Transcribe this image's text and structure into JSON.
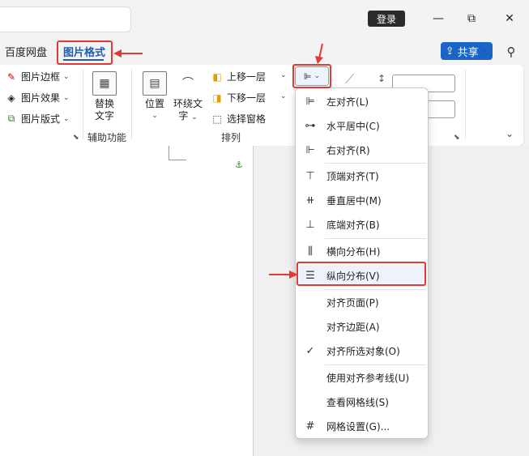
{
  "titlebar": {
    "login_label": "登录",
    "minimize_icon": "—",
    "restore_icon": "⧉",
    "close_icon": "✕"
  },
  "tabs": {
    "baidu": "百度网盘",
    "picture_format": "图片格式"
  },
  "share": {
    "label": "共享",
    "chevron": "⌄"
  },
  "ribbon": {
    "picture_border": "图片边框",
    "picture_effects": "图片效果",
    "picture_layout": "图片版式",
    "alt_text_line1": "替换",
    "alt_text_line2": "文字",
    "accessibility_group": "辅助功能",
    "position": "位置",
    "wrap_text_line1": "环绕文",
    "wrap_text_line2": "字",
    "bring_forward": "上移一层",
    "send_backward": "下移一层",
    "selection_pane": "选择窗格",
    "arrange_group": "排列"
  },
  "align_menu": {
    "items": [
      {
        "label": "左对齐(L)",
        "icon": "align-left-icon"
      },
      {
        "label": "水平居中(C)",
        "icon": "align-center-icon"
      },
      {
        "label": "右对齐(R)",
        "icon": "align-right-icon"
      },
      {
        "label": "顶端对齐(T)",
        "icon": "align-top-icon"
      },
      {
        "label": "垂直居中(M)",
        "icon": "align-middle-icon"
      },
      {
        "label": "底端对齐(B)",
        "icon": "align-bottom-icon"
      },
      {
        "label": "横向分布(H)",
        "icon": "distribute-horizontal-icon"
      },
      {
        "label": "纵向分布(V)",
        "icon": "distribute-vertical-icon"
      },
      {
        "label": "对齐页面(P)",
        "icon": ""
      },
      {
        "label": "对齐边距(A)",
        "icon": ""
      },
      {
        "label": "对齐所选对象(O)",
        "icon": "checkmark-icon"
      },
      {
        "label": "使用对齐参考线(U)",
        "icon": ""
      },
      {
        "label": "查看网格线(S)",
        "icon": ""
      },
      {
        "label": "网格设置(G)...",
        "icon": "grid-icon"
      }
    ]
  },
  "colors": {
    "accent": "#1a5fb4",
    "annotation_red": "#e53935",
    "share_blue": "#1a64c8"
  }
}
